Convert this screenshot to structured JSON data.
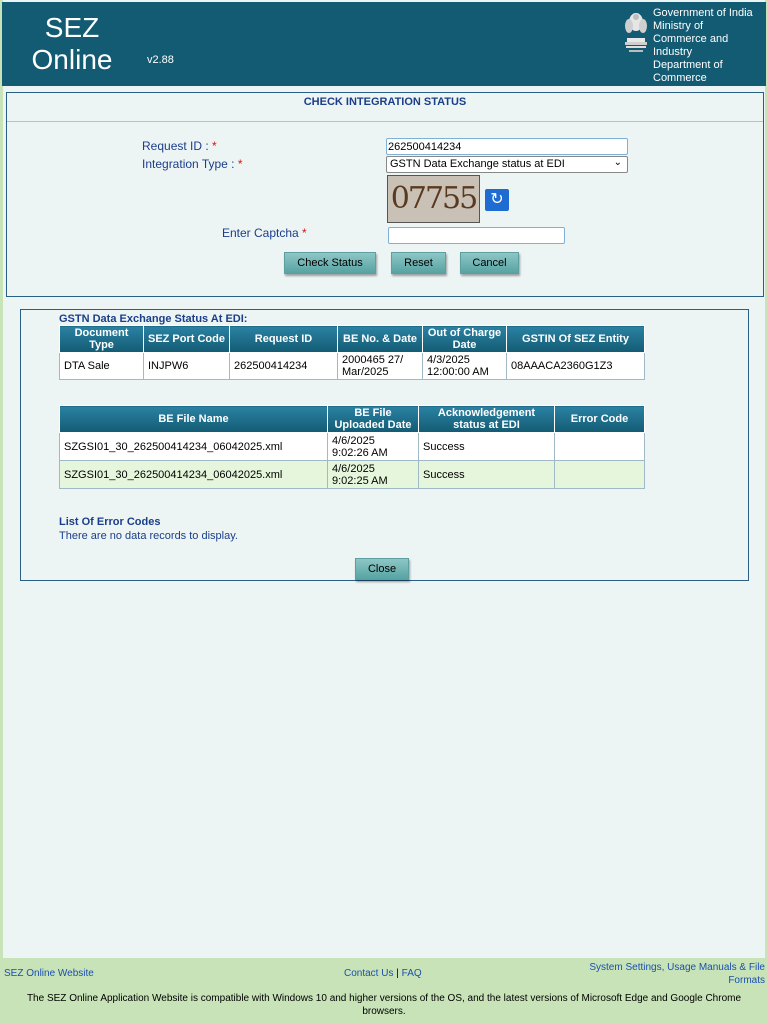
{
  "header": {
    "brand_line1": "SEZ",
    "brand_line2": "Online",
    "version": "v2.88",
    "gov_line1": "Government of India",
    "gov_line2": "Ministry of",
    "gov_line3": "Commerce and",
    "gov_line4": "Industry",
    "gov_line5": "Department of",
    "gov_line6": "Commerce"
  },
  "check": {
    "title": "CHECK INTEGRATION STATUS",
    "request_id_label": "Request ID : ",
    "request_id_value": "262500414234",
    "integration_type_label": "Integration Type : ",
    "integration_type_value": "GSTN Data Exchange status at EDI",
    "captcha_text": "07755",
    "captcha_label": "Enter Captcha ",
    "captcha_value": "",
    "required_mark": "*",
    "check_status_label": "Check Status",
    "reset_label": "Reset",
    "cancel_label": "Cancel"
  },
  "result": {
    "section_title": "GSTN Data Exchange Status At EDI:",
    "table1": {
      "headers": [
        "Document Type",
        "SEZ Port Code",
        "Request ID",
        "BE No. & Date",
        "Out of Charge Date",
        "GSTIN Of SEZ Entity"
      ],
      "rows": [
        [
          "DTA Sale",
          "INJPW6",
          "262500414234",
          "2000465 27/ Mar/2025",
          "4/3/2025 12:00:00 AM",
          "08AAACA2360G1Z3"
        ]
      ]
    },
    "table2": {
      "headers": [
        "BE File Name",
        "BE File Uploaded Date",
        "Acknowledgement status at EDI",
        "Error Code"
      ],
      "rows": [
        [
          "SZGSI01_30_262500414234_06042025.xml",
          "4/6/2025 9:02:26 AM",
          "Success",
          ""
        ],
        [
          "SZGSI01_30_262500414234_06042025.xml",
          "4/6/2025 9:02:25 AM",
          "Success",
          ""
        ]
      ]
    },
    "error_codes_title": "List Of Error Codes",
    "no_records_text": "There are no data records to display.",
    "close_label": "Close"
  },
  "footer": {
    "website_link": "SEZ Online Website",
    "contact_link": "Contact Us",
    "separator": "|",
    "faq_link": "FAQ",
    "system_link_line1": "System Settings, Usage Manuals & File",
    "system_link_line2": "Formats",
    "note": "The SEZ Online Application Website is compatible with Windows 10 and higher versions of the OS, and the latest versions of Microsoft Edge and Google Chrome browsers."
  },
  "colors": {
    "header_bg": "#135b73",
    "page_bg": "#edf4f4",
    "footer_bg": "#c8e3b8",
    "label_blue": "#1a3e8a",
    "button_teal": "#57a3a3"
  }
}
